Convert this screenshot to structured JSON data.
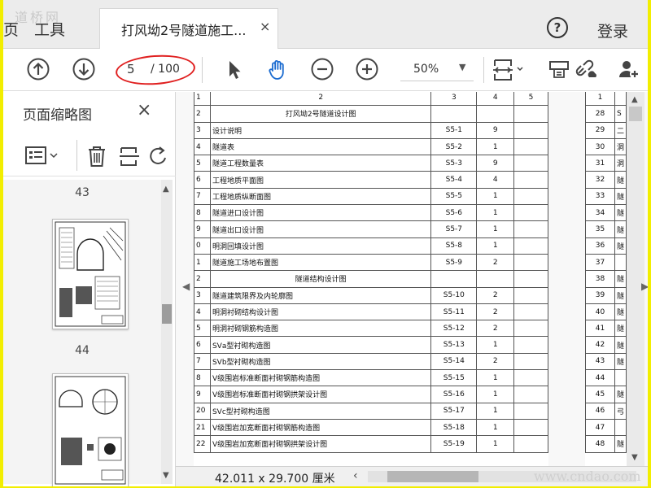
{
  "colors": {
    "border_frame": "#f2ee00",
    "annotation_ring": "#e02020"
  },
  "watermarks": {
    "top_left": "道桥网",
    "bottom_right": "www.cndao.com"
  },
  "tabs": {
    "left_partial": "页",
    "tools": "工具",
    "document_title": "打风坳2号隧道施工...",
    "close": "×"
  },
  "header": {
    "help": "?",
    "login": "登录"
  },
  "toolbar": {
    "page_current": "5",
    "page_total": "/ 100",
    "zoom": "50%",
    "icons": [
      "arrow-up-icon",
      "arrow-down-icon",
      "cursor-icon",
      "hand-icon",
      "zoom-out-icon",
      "zoom-in-icon",
      "fit-page-icon",
      "print-icon",
      "link-icon",
      "add-user-icon"
    ]
  },
  "sidebar": {
    "title": "页面缩略图",
    "close": "×",
    "page_labels": [
      "43",
      "44"
    ]
  },
  "document": {
    "table_rows": [
      {
        "no": "1",
        "name": "2",
        "fig": "3",
        "count": "4",
        "remark": "5",
        "kind": "header-numbers"
      },
      {
        "no": "2",
        "name": "打风坳2号隧道设计图",
        "fig": "",
        "count": "",
        "remark": "",
        "kind": "section"
      },
      {
        "no": "3",
        "name": "设计说明",
        "fig": "S5-1",
        "count": "9",
        "remark": ""
      },
      {
        "no": "4",
        "name": "隧道表",
        "fig": "S5-2",
        "count": "1",
        "remark": ""
      },
      {
        "no": "5",
        "name": "隧道工程数量表",
        "fig": "S5-3",
        "count": "9",
        "remark": ""
      },
      {
        "no": "6",
        "name": "工程地质平面图",
        "fig": "S5-4",
        "count": "4",
        "remark": ""
      },
      {
        "no": "7",
        "name": "工程地质纵断面图",
        "fig": "S5-5",
        "count": "1",
        "remark": ""
      },
      {
        "no": "8",
        "name": "隧道进口设计图",
        "fig": "S5-6",
        "count": "1",
        "remark": ""
      },
      {
        "no": "9",
        "name": "隧道出口设计图",
        "fig": "S5-7",
        "count": "1",
        "remark": ""
      },
      {
        "no": "0",
        "name": "明洞回填设计图",
        "fig": "S5-8",
        "count": "1",
        "remark": ""
      },
      {
        "no": "1",
        "name": "隧道施工场地布置图",
        "fig": "S5-9",
        "count": "2",
        "remark": ""
      },
      {
        "no": "2",
        "name": "隧道结构设计图",
        "fig": "",
        "count": "",
        "remark": "",
        "kind": "section"
      },
      {
        "no": "3",
        "name": "隧道建筑限界及内轮廓图",
        "fig": "S5-10",
        "count": "2",
        "remark": ""
      },
      {
        "no": "4",
        "name": "明洞衬砌结构设计图",
        "fig": "S5-11",
        "count": "2",
        "remark": ""
      },
      {
        "no": "5",
        "name": "明洞衬砌钢筋构造图",
        "fig": "S5-12",
        "count": "2",
        "remark": ""
      },
      {
        "no": "6",
        "name": "SⅤa型衬砌构造图",
        "fig": "S5-13",
        "count": "1",
        "remark": ""
      },
      {
        "no": "7",
        "name": "SⅤb型衬砌构造图",
        "fig": "S5-14",
        "count": "2",
        "remark": ""
      },
      {
        "no": "8",
        "name": "Ⅴ级围岩标准断面衬砌钢筋构造图",
        "fig": "S5-15",
        "count": "1",
        "remark": ""
      },
      {
        "no": "9",
        "name": "Ⅴ级围岩标准断面衬砌钢拱架设计图",
        "fig": "S5-16",
        "count": "1",
        "remark": ""
      },
      {
        "no": "20",
        "name": "SⅤc型衬砌构造图",
        "fig": "S5-17",
        "count": "1",
        "remark": ""
      },
      {
        "no": "21",
        "name": "Ⅴ级围岩加宽断面衬砌钢筋构造图",
        "fig": "S5-18",
        "count": "1",
        "remark": ""
      },
      {
        "no": "22",
        "name": "Ⅴ级围岩加宽断面衬砌钢拱架设计图",
        "fig": "S5-19",
        "count": "1",
        "remark": ""
      }
    ],
    "right_column_numbers": [
      "1",
      "28",
      "29",
      "30",
      "31",
      "32",
      "33",
      "34",
      "35",
      "36",
      "37",
      "38",
      "39",
      "40",
      "41",
      "42",
      "43",
      "44",
      "45",
      "46",
      "47",
      "48"
    ],
    "right_column_letters": [
      "",
      "S",
      "二",
      "洞",
      "洞",
      "隧",
      "隧",
      "隧",
      "隧",
      "隧",
      "",
      "隧",
      "隧",
      "隧",
      "隧",
      "隧",
      "隧",
      "",
      "隧",
      "弓",
      "",
      "隧"
    ]
  },
  "status": {
    "page_size": "42.011 x 29.700 厘米"
  }
}
